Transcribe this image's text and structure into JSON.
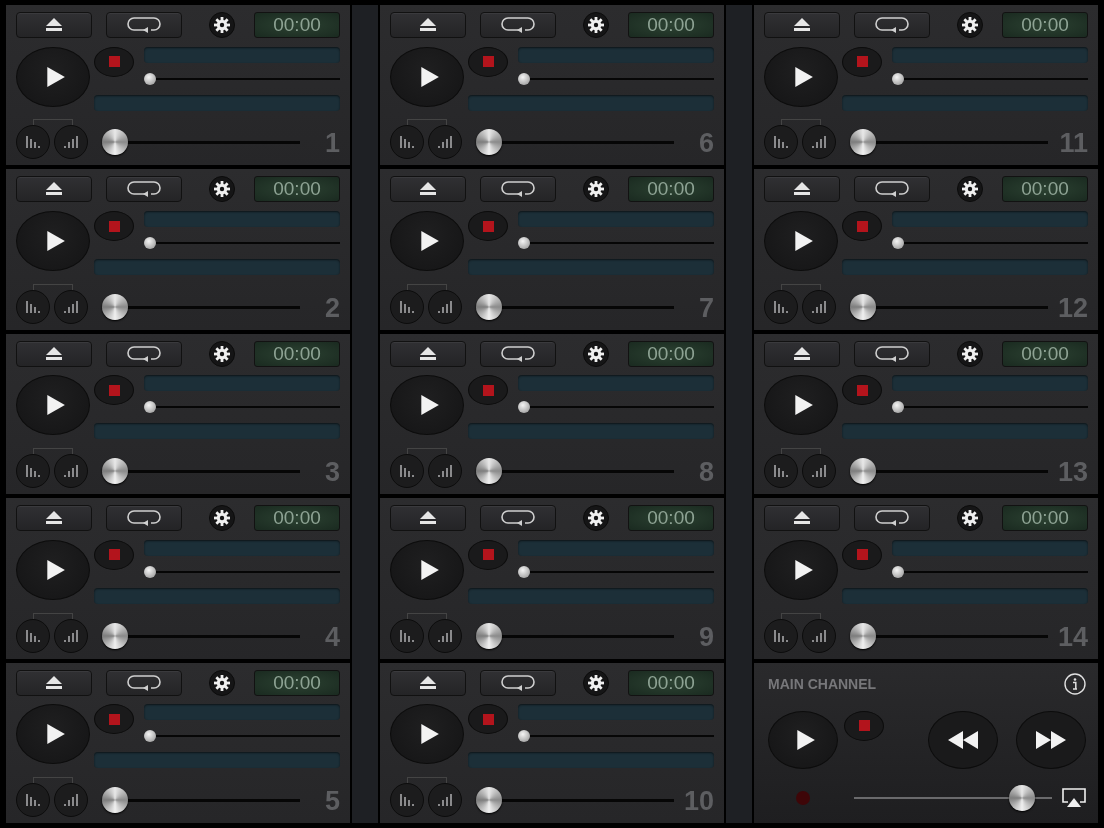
{
  "channels": [
    {
      "number": "1",
      "time": "00:00",
      "position": {
        "level": 0
      },
      "volume": {
        "level": 0
      }
    },
    {
      "number": "2",
      "time": "00:00",
      "position": {
        "level": 0
      },
      "volume": {
        "level": 0
      }
    },
    {
      "number": "3",
      "time": "00:00",
      "position": {
        "level": 0
      },
      "volume": {
        "level": 0
      }
    },
    {
      "number": "4",
      "time": "00:00",
      "position": {
        "level": 0
      },
      "volume": {
        "level": 0
      }
    },
    {
      "number": "5",
      "time": "00:00",
      "position": {
        "level": 0
      },
      "volume": {
        "level": 0
      }
    },
    {
      "number": "6",
      "time": "00:00",
      "position": {
        "level": 0
      },
      "volume": {
        "level": 0
      }
    },
    {
      "number": "7",
      "time": "00:00",
      "position": {
        "level": 0
      },
      "volume": {
        "level": 0
      }
    },
    {
      "number": "8",
      "time": "00:00",
      "position": {
        "level": 0
      },
      "volume": {
        "level": 0
      }
    },
    {
      "number": "9",
      "time": "00:00",
      "position": {
        "level": 0
      },
      "volume": {
        "level": 0
      }
    },
    {
      "number": "10",
      "time": "00:00",
      "position": {
        "level": 0
      },
      "volume": {
        "level": 0
      }
    },
    {
      "number": "11",
      "time": "00:00",
      "position": {
        "level": 0
      },
      "volume": {
        "level": 0
      }
    },
    {
      "number": "12",
      "time": "00:00",
      "position": {
        "level": 0
      },
      "volume": {
        "level": 0
      }
    },
    {
      "number": "13",
      "time": "00:00",
      "position": {
        "level": 0
      },
      "volume": {
        "level": 0
      }
    },
    {
      "number": "14",
      "time": "00:00",
      "position": {
        "level": 0
      },
      "volume": {
        "level": 0
      }
    }
  ],
  "main_channel": {
    "title": "MAIN CHANNEL",
    "recording": false,
    "volume": {
      "level": 0.9
    }
  }
}
